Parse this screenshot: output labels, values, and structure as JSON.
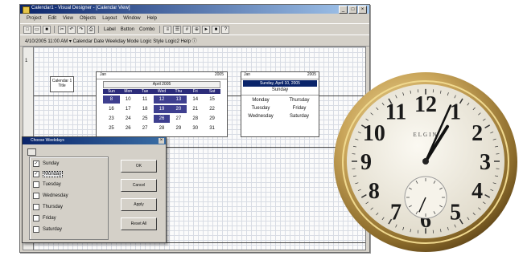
{
  "window": {
    "title": "Calendar1 - Visual Designer - [Calendar View]",
    "buttons": [
      "_",
      "□",
      "×"
    ]
  },
  "menubar": [
    "Project",
    "Edit",
    "View",
    "Objects",
    "Layout",
    "Window",
    "Help"
  ],
  "toolbar1": {
    "labels": [
      "Label",
      "Button",
      "Combo"
    ],
    "icons": [
      "new-icon",
      "open-icon",
      "save-icon",
      "cut-icon",
      "undo-icon",
      "redo-icon",
      "print-icon"
    ]
  },
  "toolbar2": {
    "text": "4/10/2005 11:00 AM ▾  Calendar  Date  Weekday  Mode  Logic  Style  Logic2  Help ⓘ"
  },
  "ruler": {
    "top": "1",
    "middle": "2",
    "bottom": "3"
  },
  "note": {
    "line1": "Calendar 1",
    "line2": "Title"
  },
  "calendar": {
    "hdr_left": "Jan",
    "hdr_right": "2005",
    "month_label": "April 2005",
    "days_of_week": [
      "Sun",
      "Mon",
      "Tue",
      "Wed",
      "Thu",
      "Fri",
      "Sat"
    ],
    "rows": [
      [
        "8",
        "10",
        "11",
        "12",
        "13",
        "14",
        "15"
      ],
      [
        "16",
        "17",
        "18",
        "19",
        "20",
        "21",
        "22"
      ],
      [
        "23",
        "24",
        "25",
        "26",
        "27",
        "28",
        "29"
      ],
      [
        "25",
        "26",
        "27",
        "28",
        "29",
        "30",
        "31"
      ]
    ],
    "highlighted": [
      "0-0",
      "0-3",
      "0-4",
      "1-3",
      "1-4",
      "2-3"
    ]
  },
  "weekday_panel": {
    "hdr_left": "Jan",
    "hdr_right": "2005",
    "selected": "Sunday, April 10, 2005",
    "single": "Sunday",
    "pairs": [
      [
        "Monday",
        "Thursday"
      ],
      [
        "Tuesday",
        "Friday"
      ],
      [
        "Wednesday",
        "Saturday"
      ]
    ]
  },
  "dialog": {
    "title": "Choose Weekdays",
    "options": [
      {
        "label": "Sunday",
        "checked": true
      },
      {
        "label": "Monday",
        "checked": true
      },
      {
        "label": "Tuesday",
        "checked": false
      },
      {
        "label": "Wednesday",
        "checked": false
      },
      {
        "label": "Thursday",
        "checked": false
      },
      {
        "label": "Friday",
        "checked": false
      },
      {
        "label": "Saturday",
        "checked": false
      }
    ],
    "buttons": {
      "ok": "OK",
      "cancel": "Cancel",
      "apply": "Apply",
      "reset": "Reset All"
    }
  },
  "watch": {
    "maker": "ELGIN",
    "numerals": [
      "12",
      "1",
      "2",
      "3",
      "4",
      "5",
      "6",
      "7",
      "8",
      "9",
      "10",
      "11"
    ],
    "time": {
      "hour": 1,
      "minute": 4
    },
    "subdial_seconds": 34,
    "colors": {
      "case": "#b8954a",
      "dial": "#f2efe6",
      "numerals": "#1a1a1a"
    }
  }
}
